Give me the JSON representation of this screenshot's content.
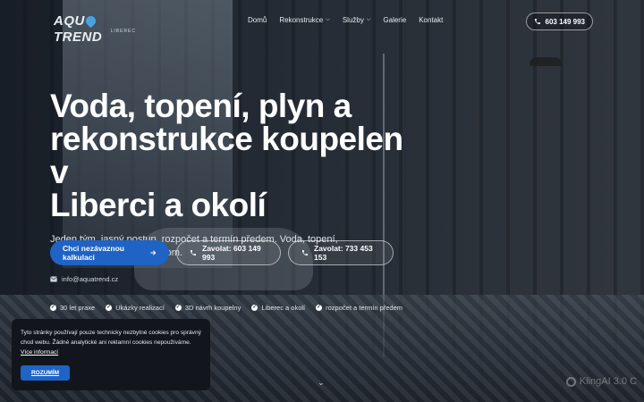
{
  "header": {
    "logo_text_left": "AQU",
    "logo_text_right": "TREND",
    "logo_sub": "LIBEREC",
    "nav": [
      {
        "label": "Domů",
        "has_caret": false
      },
      {
        "label": "Rekonstrukce",
        "has_caret": true
      },
      {
        "label": "Služby",
        "has_caret": true
      },
      {
        "label": "Galerie",
        "has_caret": false
      },
      {
        "label": "Kontakt",
        "has_caret": false
      }
    ],
    "phone": "603 149 993"
  },
  "hero": {
    "title_lines": [
      "Voda, topení, plyn a",
      "rekonstrukce koupelen v",
      "Liberci a okolí"
    ],
    "lead": "Jeden tým, jasný postup, rozpočet a termín předem. Voda, topení, obklady i dokončení v jednom.",
    "cta_primary": "Chci nezávaznou kalkulaci",
    "cta_call_1": "Zavolat: 603 149 993",
    "cta_call_2": "Zavolat: 733 453 153",
    "email": "info@aquatrend.cz",
    "features": [
      "30 let praxe",
      "Ukázky realizací",
      "3D návrh koupelny",
      "Liberec a okolí",
      "rozpočet a termín předem"
    ]
  },
  "cookie": {
    "text": "Tyto stránky používají pouze technicky nezbytné cookies pro správný chod webu. Žádné analytické ani reklamní cookies nepoužíváme.",
    "link": "Více informací",
    "button": "ROZUMÍM"
  },
  "watermark": "KlingAI 3.0 C",
  "colors": {
    "accent": "#1f63c4",
    "banner_bg": "#12161c",
    "logo_drop": "#4aa3e0"
  },
  "icons": [
    "phone-icon",
    "arrow-right-icon",
    "mail-icon",
    "check-circle-icon",
    "chevron-down-icon"
  ]
}
